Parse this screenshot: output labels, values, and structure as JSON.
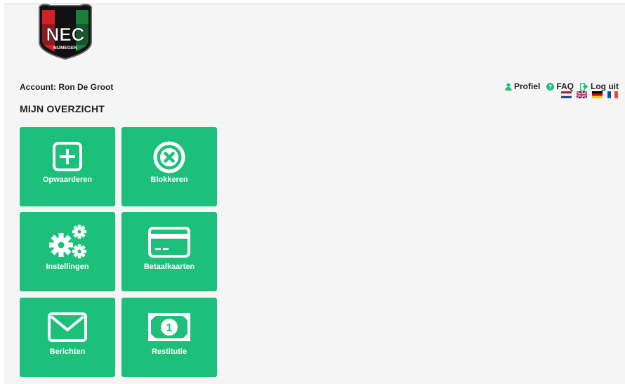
{
  "header": {
    "account_label": "Account: Ron De Groot",
    "page_title": "MIJN OVERZICHT",
    "logo_text": "NEC",
    "logo_subtext": "NIJMEGEN"
  },
  "nav": {
    "profile": "Profiel",
    "faq": "FAQ",
    "logout": "Log uit"
  },
  "languages": [
    "nl",
    "en",
    "de",
    "fr"
  ],
  "tiles": [
    {
      "label": "Opwaarderen",
      "icon": "plus-square-icon"
    },
    {
      "label": "Blokkeren",
      "icon": "close-circle-icon"
    },
    {
      "label": "Instellingen",
      "icon": "gears-icon"
    },
    {
      "label": "Betaalkaarten",
      "icon": "credit-card-icon"
    },
    {
      "label": "Berichten",
      "icon": "envelope-icon"
    },
    {
      "label": "Restitutie",
      "icon": "banknote-icon"
    }
  ],
  "colors": {
    "tile": "#1cc07a",
    "accent": "#1cc07a",
    "background": "#f5f5f5"
  }
}
